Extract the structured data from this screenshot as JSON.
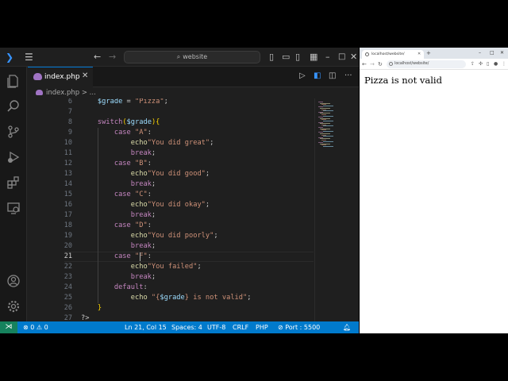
{
  "vscode": {
    "search": {
      "label": "website"
    },
    "tab": {
      "label": "index.php"
    },
    "breadcrumb": {
      "file": "index.php",
      "more": "> ..."
    },
    "code": {
      "lines": [
        {
          "num": "6",
          "tokens": [
            [
              "var",
              "    $grade"
            ],
            [
              "plain",
              " = "
            ],
            [
              "str",
              "\"Pizza\""
            ],
            [
              "plain",
              ";"
            ]
          ]
        },
        {
          "num": "7",
          "tokens": []
        },
        {
          "num": "8",
          "tokens": [
            [
              "kw",
              "    switch"
            ],
            [
              "br2",
              "("
            ],
            [
              "var",
              "$grade"
            ],
            [
              "br2",
              ")"
            ],
            [
              "br2",
              "{"
            ]
          ]
        },
        {
          "num": "9",
          "tokens": [
            [
              "kw",
              "        case "
            ],
            [
              "str",
              "\"A\""
            ],
            [
              "plain",
              ":"
            ]
          ]
        },
        {
          "num": "10",
          "tokens": [
            [
              "fn",
              "            echo"
            ],
            [
              "str",
              "\"You did great\""
            ],
            [
              "plain",
              ";"
            ]
          ]
        },
        {
          "num": "11",
          "tokens": [
            [
              "kw",
              "            break"
            ],
            [
              "plain",
              ";"
            ]
          ]
        },
        {
          "num": "12",
          "tokens": [
            [
              "kw",
              "        case "
            ],
            [
              "str",
              "\"B\""
            ],
            [
              "plain",
              ":"
            ]
          ]
        },
        {
          "num": "13",
          "tokens": [
            [
              "fn",
              "            echo"
            ],
            [
              "str",
              "\"You did good\""
            ],
            [
              "plain",
              ";"
            ]
          ]
        },
        {
          "num": "14",
          "tokens": [
            [
              "kw",
              "            break"
            ],
            [
              "plain",
              ";"
            ]
          ]
        },
        {
          "num": "15",
          "tokens": [
            [
              "kw",
              "        case "
            ],
            [
              "str",
              "\"C\""
            ],
            [
              "plain",
              ":"
            ]
          ]
        },
        {
          "num": "16",
          "tokens": [
            [
              "fn",
              "            echo"
            ],
            [
              "str",
              "\"You did okay\""
            ],
            [
              "plain",
              ";"
            ]
          ]
        },
        {
          "num": "17",
          "tokens": [
            [
              "kw",
              "            break"
            ],
            [
              "plain",
              ";"
            ]
          ]
        },
        {
          "num": "18",
          "tokens": [
            [
              "kw",
              "        case "
            ],
            [
              "str",
              "\"D\""
            ],
            [
              "plain",
              ":"
            ]
          ]
        },
        {
          "num": "19",
          "tokens": [
            [
              "fn",
              "            echo"
            ],
            [
              "str",
              "\"You did poorly\""
            ],
            [
              "plain",
              ";"
            ]
          ]
        },
        {
          "num": "20",
          "tokens": [
            [
              "kw",
              "            break"
            ],
            [
              "plain",
              ";"
            ]
          ]
        },
        {
          "num": "21",
          "tokens": [
            [
              "kw",
              "        case "
            ],
            [
              "str",
              "\"F\""
            ],
            [
              "plain",
              ":"
            ]
          ]
        },
        {
          "num": "22",
          "tokens": [
            [
              "fn",
              "            echo"
            ],
            [
              "str",
              "\"You failed\""
            ],
            [
              "plain",
              ";"
            ]
          ]
        },
        {
          "num": "23",
          "tokens": [
            [
              "kw",
              "            break"
            ],
            [
              "plain",
              ";"
            ]
          ]
        },
        {
          "num": "24",
          "tokens": [
            [
              "kw",
              "        default"
            ],
            [
              "plain",
              ":"
            ]
          ]
        },
        {
          "num": "25",
          "tokens": [
            [
              "fn",
              "            echo "
            ],
            [
              "str",
              "\"{"
            ],
            [
              "var",
              "$grade"
            ],
            [
              "str",
              "} is not valid\""
            ],
            [
              "plain",
              ";"
            ]
          ]
        },
        {
          "num": "26",
          "tokens": [
            [
              "br2",
              "    }"
            ]
          ]
        },
        {
          "num": "27",
          "tokens": [
            [
              "plain",
              "?>"
            ]
          ]
        }
      ],
      "active_line": "21"
    },
    "status": {
      "errors": "0",
      "warnings": "0",
      "position": "Ln 21, Col 15",
      "spaces": "Spaces: 4",
      "encoding": "UTF-8",
      "eol": "CRLF",
      "language": "PHP",
      "port": "Port : 5500"
    },
    "icons": [
      "vscode-logo-icon",
      "menu-icon",
      "back-arrow-icon",
      "forward-arrow-icon",
      "search-icon",
      "layout-icon",
      "explorer-icon",
      "search-icon",
      "source-control-icon",
      "run-debug-icon",
      "extensions-icon",
      "remote-explorer-icon",
      "account-icon",
      "settings-gear-icon",
      "run-icon",
      "split-editor-icon",
      "more-icon"
    ],
    "colors": {
      "accent": "#007acc",
      "keyword": "#c586c0",
      "string": "#ce9178",
      "variable": "#9cdcfe",
      "function": "#dcdcaa"
    }
  },
  "browser": {
    "tab_title": "localhost/website/",
    "url": "localhost/website/",
    "output": "Pizza is not valid"
  }
}
